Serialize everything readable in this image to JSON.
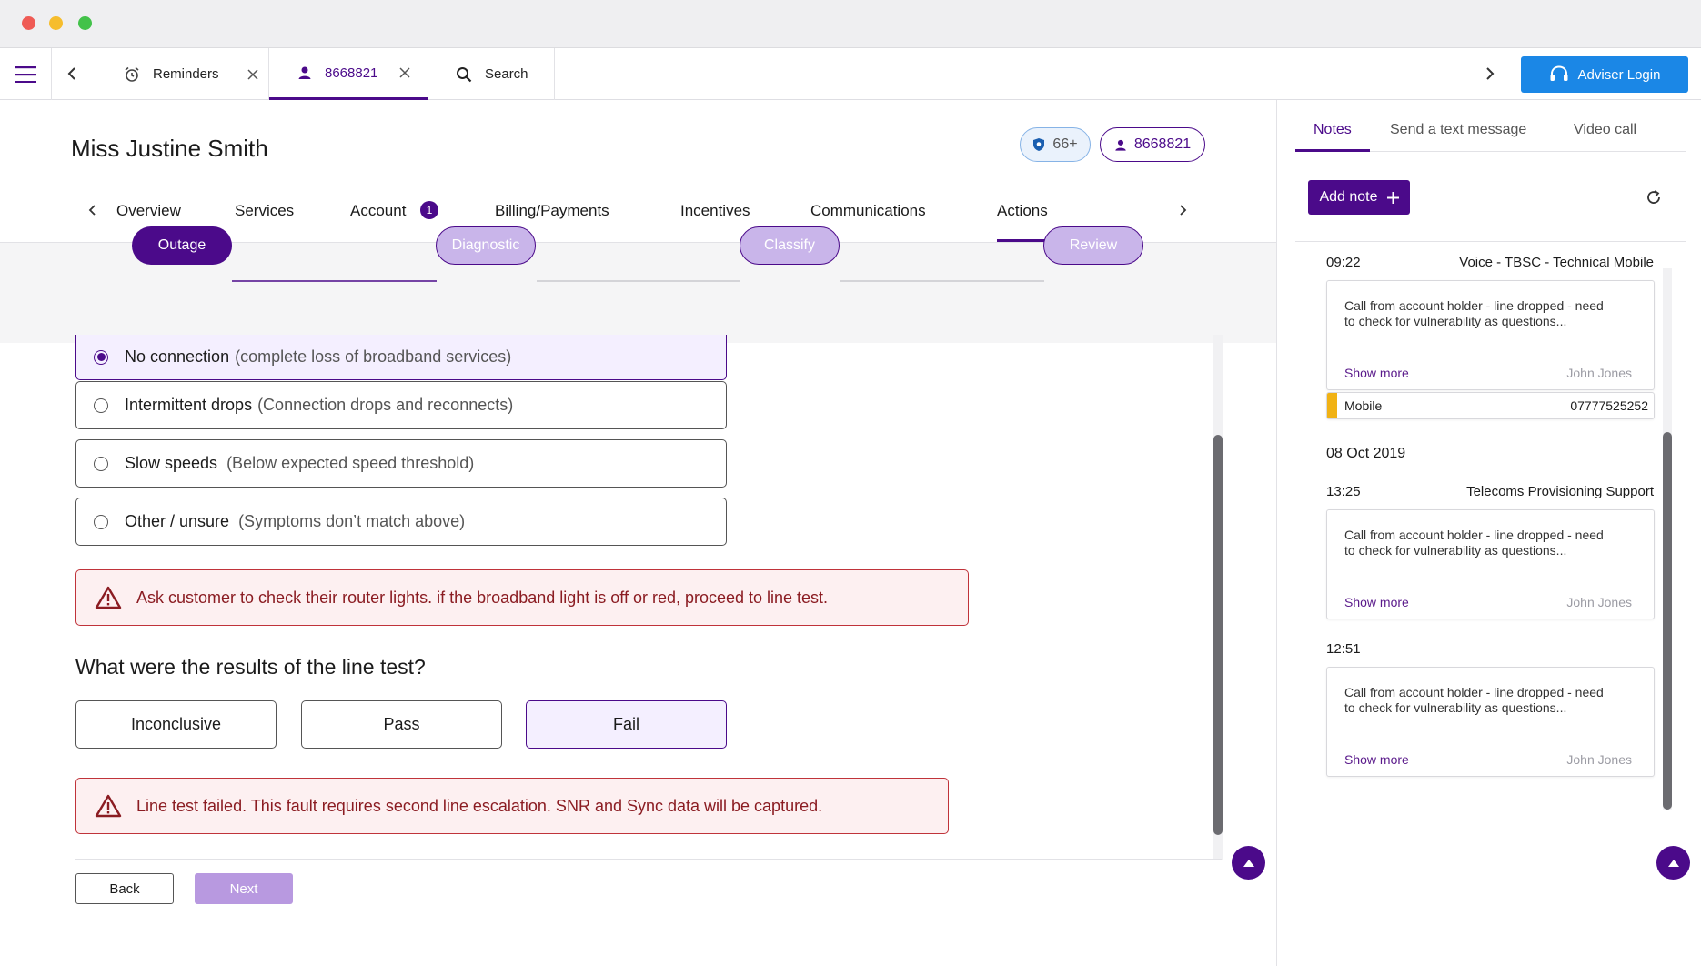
{
  "window": {
    "title": ""
  },
  "tabs": [
    {
      "label": "Reminders"
    },
    {
      "label": "8668821"
    },
    {
      "label": "Search"
    }
  ],
  "adviser_login": "Adviser Login",
  "customer": {
    "name": "Miss Justine Smith",
    "age_badge": "66+",
    "account_id": "8668821"
  },
  "nav_tabs": [
    {
      "label": "Overview"
    },
    {
      "label": "Services"
    },
    {
      "label": "Account",
      "badge": "1"
    },
    {
      "label": "Billing/Payments"
    },
    {
      "label": "Incentives"
    },
    {
      "label": "Communications"
    },
    {
      "label": "Actions"
    }
  ],
  "steps": [
    {
      "label": "Outage"
    },
    {
      "label": "Diagnostic"
    },
    {
      "label": "Classify"
    },
    {
      "label": "Review"
    }
  ],
  "symptoms": [
    {
      "label": "No connection",
      "desc": "(complete loss of broadband services)",
      "selected": true
    },
    {
      "label": "Intermittent drops",
      "desc": "(Connection drops and reconnects)",
      "selected": false
    },
    {
      "label": "Slow speeds",
      "desc": "(Below expected speed threshold)",
      "selected": false
    },
    {
      "label": "Other / unsure",
      "desc": "(Symptoms don’t match above)",
      "selected": false
    }
  ],
  "alert_router": "Ask customer to check their router lights. if the broadband light is off or red, proceed to line test.",
  "line_test": {
    "question": "What were the results of the line test?",
    "options": [
      "Inconclusive",
      "Pass",
      "Fail"
    ],
    "selected": "Fail"
  },
  "alert_fail": "Line test failed. This fault requires second line escalation. SNR and Sync data will be captured.",
  "footer": {
    "back": "Back",
    "next": "Next"
  },
  "right_tabs": [
    {
      "label": "Notes"
    },
    {
      "label": "Send a text message"
    },
    {
      "label": "Video call"
    }
  ],
  "add_note": "Add note",
  "notes": {
    "n1": {
      "time": "09:22",
      "team": "Voice - TBSC - Technical Mobile",
      "text": "Call from account holder - line dropped - need to check for vulnerability as questions...",
      "show_more": "Show more",
      "author": "John Jones",
      "contact_type": "Mobile",
      "contact_number": "07777525252"
    },
    "date_header": "08 Oct 2019",
    "n2": {
      "time": "13:25",
      "team": "Telecoms Provisioning Support",
      "text": "Call from account holder - line dropped - need to check for vulnerability as questions...",
      "show_more": "Show more",
      "author": "John Jones"
    },
    "n3": {
      "time": "12:51",
      "text": "Call from account holder - line dropped - need to check for vulnerability as questions...",
      "show_more": "Show more",
      "author": "John Jones"
    }
  },
  "colors": {
    "brand": "#4b0a8a",
    "brand_light": "#d6c5ef",
    "adviser": "#1b87e6",
    "alert_border": "#c0333a",
    "alert_bg": "#fdf0f1",
    "note_accent": "#f1b214"
  }
}
